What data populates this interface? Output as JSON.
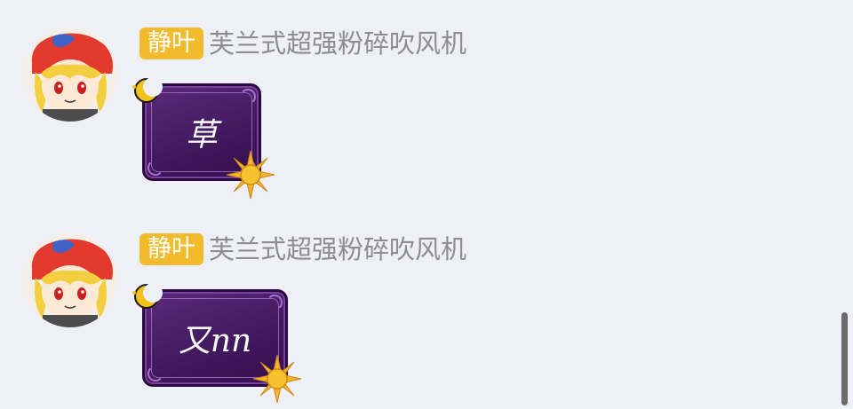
{
  "messages": [
    {
      "badge": "静叶",
      "nickname": "芙兰式超强粉碎吹风机",
      "text": "草"
    },
    {
      "badge": "静叶",
      "nickname": "芙兰式超强粉碎吹风机",
      "text": "又nn"
    }
  ],
  "colors": {
    "background": "#eff0f7",
    "badge": "#f2bb2c",
    "nickname": "#8c8c92",
    "bubble": "#3d1559",
    "bubble_border": "#2a0a3c",
    "bubble_text": "#ffffff",
    "scrollbar": "#6b6b6b"
  },
  "icons": [
    "avatar",
    "moon-icon",
    "sun-icon"
  ]
}
